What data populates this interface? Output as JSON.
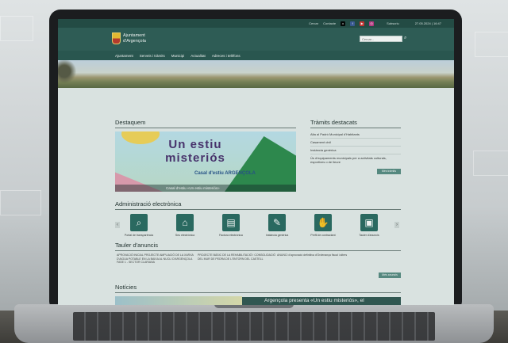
{
  "topbar": {
    "links": [
      "Cercar",
      "Contacte"
    ],
    "subscribe": "Subscriu",
    "date": "27.05.2024 | 16:47"
  },
  "header": {
    "logo_line1": "Ajuntament",
    "logo_line2": "d'Argençola",
    "search_placeholder": "Cercar..."
  },
  "nav": [
    "Ajuntament",
    "Serveis i tràmits",
    "Municipi",
    "Actualitat",
    "Adreces i telèfons"
  ],
  "destaquem": {
    "title": "Destaquem",
    "promo_title": "Un estiu misteriós",
    "promo_sub": "Casal d'estiu ARGENÇOLA",
    "caption": "Casal d'estiu «Un estiu misteriós»"
  },
  "tramits": {
    "title": "Tràmits destacats",
    "items": [
      "Alta al Padró Municipal d'Habitants",
      "Casament civil",
      "Instància genèrica",
      "Ús d'equipaments municipals per a activitats culturals, esportives o de lleure"
    ],
    "button": "Més tràmits"
  },
  "admin": {
    "title": "Administració electrònica",
    "tiles": [
      {
        "label": "Portal de transparència",
        "icon": "magnifier-icon"
      },
      {
        "label": "Seu electrònica",
        "icon": "building-icon"
      },
      {
        "label": "Factura electrònica",
        "icon": "invoice-icon"
      },
      {
        "label": "Instància genèrica",
        "icon": "form-icon"
      },
      {
        "label": "Perfil de contractant",
        "icon": "handshake-icon"
      },
      {
        "label": "Tauler d'anuncis",
        "icon": "board-icon"
      }
    ]
  },
  "tauler": {
    "title": "Tauler d'anuncis",
    "items": [
      "APROVACIÓ INICIAL PROJECTE AMPLIACIÓ DE LA XARXA D'AIGUA POTABLE EN LA BAIXA AL NUCLI D'ARGENÇOLA FASE 1 - SECTOR CLARIANA",
      "PROJECTE BÀSIC DE LA REHABILITACIÓ I CONSOLIDACIÓ DEL MUR DE PEDRA DE L'ENTORN DEL CASTELL",
      "ANUNCI d'aprovació definitiva d'Ordenança fiscal i altres"
    ],
    "button": "Més anuncis"
  },
  "noticies": {
    "title": "Notícies",
    "overlay": "Argençola presenta «Un estiu misteriós», el"
  }
}
